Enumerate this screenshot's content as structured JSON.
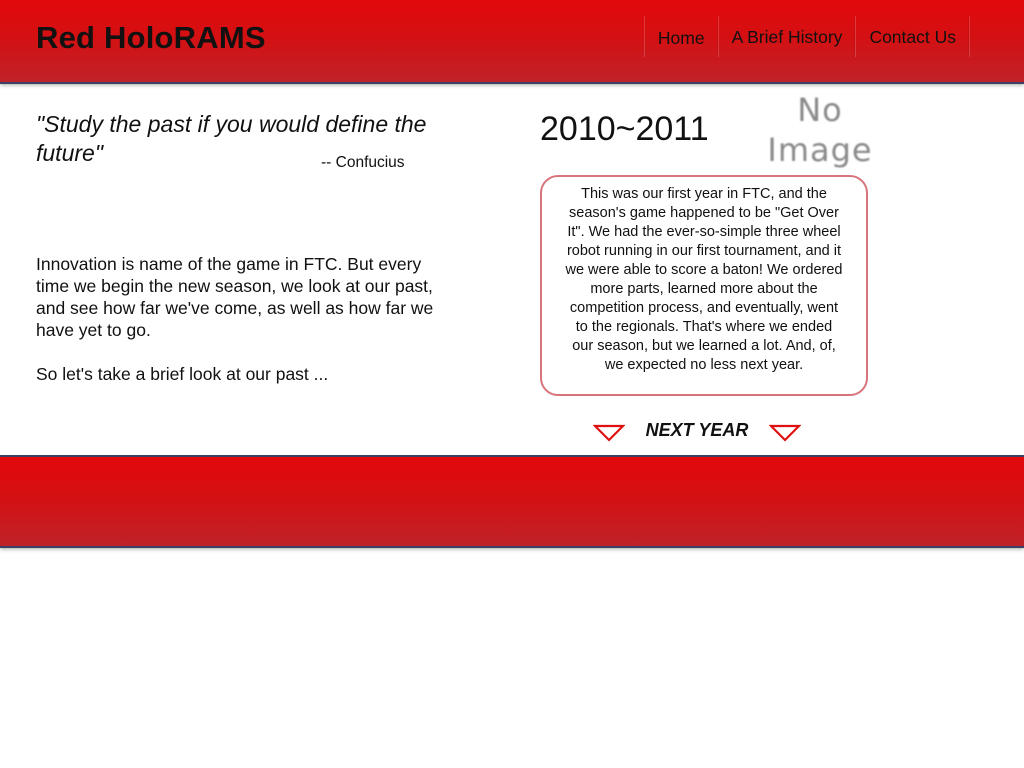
{
  "header": {
    "site_title": "Red HoloRAMS",
    "nav": [
      {
        "label": "Home"
      },
      {
        "label": "A Brief History"
      },
      {
        "label": "Contact Us"
      }
    ]
  },
  "quote": {
    "text": "\"Study the past if you would define the future\"",
    "author": "-- Confucius"
  },
  "intro": {
    "paragraph_1": "Innovation is name of the game in FTC. But every time we begin the new season, we look at our past, and see how far we've come, as well as how far we have yet to go.",
    "paragraph_2": "So let's take a brief look at our past ..."
  },
  "history": {
    "year": "2010~2011",
    "image_placeholder": "No Image",
    "description": "This was our first year in FTC, and the season's game happened to be \"Get Over It\". We had the ever-so-simple three wheel robot running in our first tournament, and it we were able to score a baton! We ordered more parts, learned more about the competition process, and eventually, went to the regionals. That's where we ended our season, but we learned a lot. And, of, we expected no less next year.",
    "next_label": "NEXT YEAR"
  },
  "colors": {
    "brand_red": "#d41012",
    "box_border": "#d8747b",
    "arrow_red": "#e01010",
    "rule_navy": "#3a3f63"
  }
}
